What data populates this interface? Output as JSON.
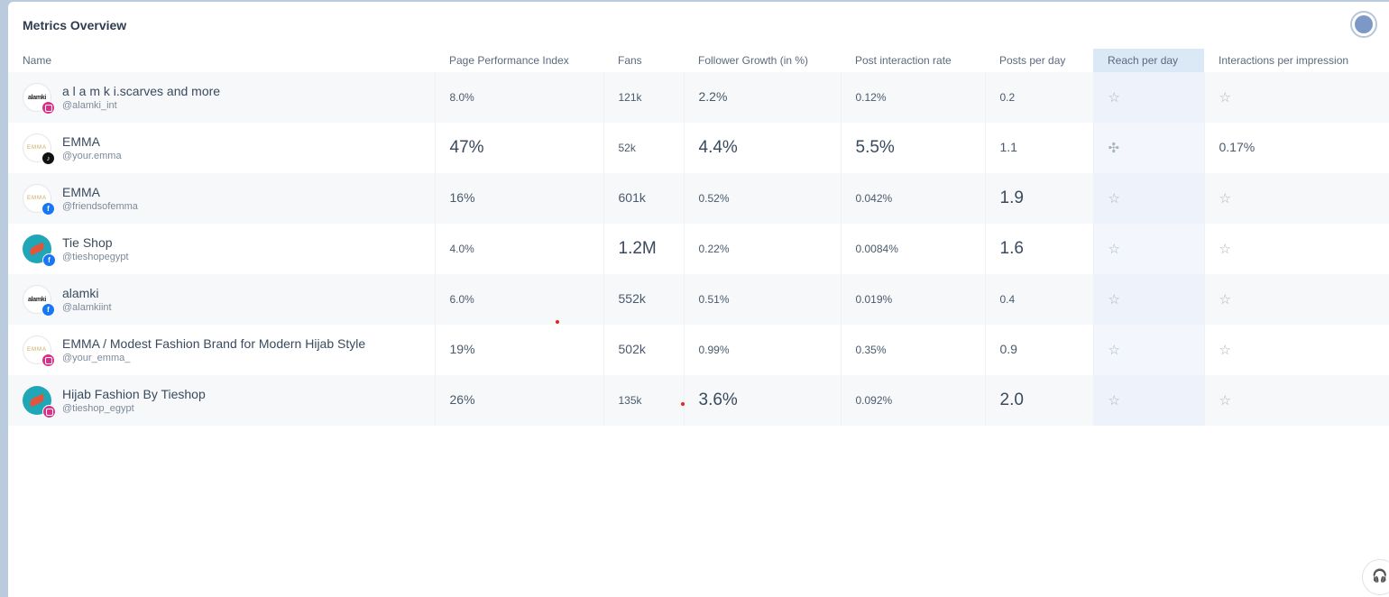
{
  "title": "Metrics Overview",
  "columns": [
    "Name",
    "Page Performance Index",
    "Fans",
    "Follower Growth (in %)",
    "Post interaction rate",
    "Posts per day",
    "Reach per day",
    "Interactions per impression"
  ],
  "rows": [
    {
      "name": "a l a m k i.scarves and more",
      "handle": "@alamki_int",
      "avatar": "alamki-logo",
      "network": "instagram",
      "ppi": "8.0%",
      "fans": "121k",
      "growth": "2.2%",
      "pir": "0.12%",
      "ppd": "0.2",
      "reach": "star-icon",
      "ipi": "star-icon"
    },
    {
      "name": "EMMA",
      "handle": "@your.emma",
      "avatar": "emma-logo",
      "network": "tiktok",
      "ppi": "47%",
      "fans": "52k",
      "growth": "4.4%",
      "pir": "5.5%",
      "ppd": "1.1",
      "reach": "puzzle-icon",
      "ipi": "0.17%"
    },
    {
      "name": "EMMA",
      "handle": "@friendsofemma",
      "avatar": "emma-logo",
      "network": "facebook",
      "ppi": "16%",
      "fans": "601k",
      "growth": "0.52%",
      "pir": "0.042%",
      "ppd": "1.9",
      "reach": "star-icon",
      "ipi": "star-icon"
    },
    {
      "name": "Tie Shop",
      "handle": "@tieshopegypt",
      "avatar": "tieshop-logo",
      "network": "facebook",
      "ppi": "4.0%",
      "fans": "1.2M",
      "growth": "0.22%",
      "pir": "0.0084%",
      "ppd": "1.6",
      "reach": "star-icon",
      "ipi": "star-icon"
    },
    {
      "name": "alamki",
      "handle": "@alamkiint",
      "avatar": "alamki-logo",
      "network": "facebook",
      "ppi": "6.0%",
      "fans": "552k",
      "growth": "0.51%",
      "pir": "0.019%",
      "ppd": "0.4",
      "reach": "star-icon",
      "ipi": "star-icon"
    },
    {
      "name": "EMMA / Modest Fashion Brand for Modern Hijab Style",
      "handle": "@your_emma_",
      "avatar": "emma-logo",
      "network": "instagram",
      "ppi": "19%",
      "fans": "502k",
      "growth": "0.99%",
      "pir": "0.35%",
      "ppd": "0.9",
      "reach": "star-icon",
      "ipi": "star-icon"
    },
    {
      "name": "Hijab Fashion By Tieshop",
      "handle": "@tieshop_egypt",
      "avatar": "tieshop-logo",
      "network": "instagram",
      "ppi": "26%",
      "fans": "135k",
      "growth": "3.6%",
      "pir": "0.092%",
      "ppd": "2.0",
      "reach": "star-icon",
      "ipi": "star-icon"
    }
  ],
  "avatar_text": {
    "alamki": "alamki",
    "emma": "EMMA"
  },
  "glyphs": {
    "star": "☆",
    "puzzle": "✣",
    "support": "🎧"
  },
  "colors": {
    "highlight_column": "#dbe9f7",
    "instagram": "#d9318a",
    "facebook": "#1877f2",
    "tiktok": "#111111"
  }
}
